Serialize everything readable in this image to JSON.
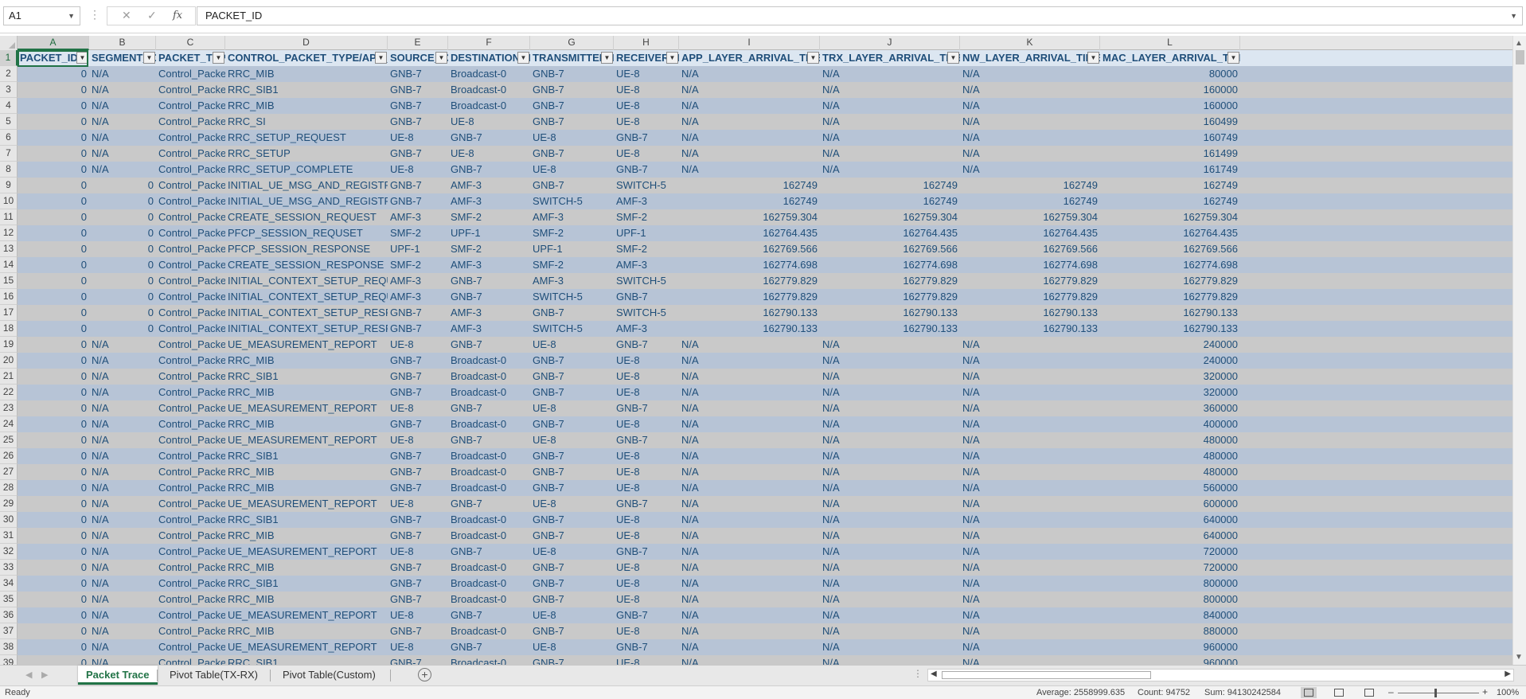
{
  "formula_bar": {
    "name_box": "A1",
    "fx_label": "fx",
    "formula": "PACKET_ID"
  },
  "columns": [
    "A",
    "B",
    "C",
    "D",
    "E",
    "F",
    "G",
    "H",
    "I",
    "J",
    "K",
    "L"
  ],
  "headers": [
    "PACKET_ID",
    "SEGMENT_ID",
    "PACKET_TYPE",
    "CONTROL_PACKET_TYPE/APP_NAME",
    "SOURCE_ID",
    "DESTINATION_ID",
    "TRANSMITTER_ID",
    "RECEIVER_ID",
    "APP_LAYER_ARRIVAL_TIME(US)",
    "TRX_LAYER_ARRIVAL_TIME(US)",
    "NW_LAYER_ARRIVAL_TIME(US)",
    "MAC_LAYER_ARRIVAL_TIME(US)"
  ],
  "rows": [
    [
      "0",
      "N/A",
      "Control_Packet",
      "RRC_MIB",
      "GNB-7",
      "Broadcast-0",
      "GNB-7",
      "UE-8",
      "N/A",
      "N/A",
      "N/A",
      "80000"
    ],
    [
      "0",
      "N/A",
      "Control_Packet",
      "RRC_SIB1",
      "GNB-7",
      "Broadcast-0",
      "GNB-7",
      "UE-8",
      "N/A",
      "N/A",
      "N/A",
      "160000"
    ],
    [
      "0",
      "N/A",
      "Control_Packet",
      "RRC_MIB",
      "GNB-7",
      "Broadcast-0",
      "GNB-7",
      "UE-8",
      "N/A",
      "N/A",
      "N/A",
      "160000"
    ],
    [
      "0",
      "N/A",
      "Control_Packet",
      "RRC_SI",
      "GNB-7",
      "UE-8",
      "GNB-7",
      "UE-8",
      "N/A",
      "N/A",
      "N/A",
      "160499"
    ],
    [
      "0",
      "N/A",
      "Control_Packet",
      "RRC_SETUP_REQUEST",
      "UE-8",
      "GNB-7",
      "UE-8",
      "GNB-7",
      "N/A",
      "N/A",
      "N/A",
      "160749"
    ],
    [
      "0",
      "N/A",
      "Control_Packet",
      "RRC_SETUP",
      "GNB-7",
      "UE-8",
      "GNB-7",
      "UE-8",
      "N/A",
      "N/A",
      "N/A",
      "161499"
    ],
    [
      "0",
      "N/A",
      "Control_Packet",
      "RRC_SETUP_COMPLETE",
      "UE-8",
      "GNB-7",
      "UE-8",
      "GNB-7",
      "N/A",
      "N/A",
      "N/A",
      "161749"
    ],
    [
      "0",
      "0",
      "Control_Packet",
      "INITIAL_UE_MSG_AND_REGISTRATION_REQUEST",
      "GNB-7",
      "AMF-3",
      "GNB-7",
      "SWITCH-5",
      "162749",
      "162749",
      "162749",
      "162749"
    ],
    [
      "0",
      "0",
      "Control_Packet",
      "INITIAL_UE_MSG_AND_REGISTRATION_REQUEST",
      "GNB-7",
      "AMF-3",
      "SWITCH-5",
      "AMF-3",
      "162749",
      "162749",
      "162749",
      "162749"
    ],
    [
      "0",
      "0",
      "Control_Packet",
      "CREATE_SESSION_REQUEST",
      "AMF-3",
      "SMF-2",
      "AMF-3",
      "SMF-2",
      "162759.304",
      "162759.304",
      "162759.304",
      "162759.304"
    ],
    [
      "0",
      "0",
      "Control_Packet",
      "PFCP_SESSION_REQUSET",
      "SMF-2",
      "UPF-1",
      "SMF-2",
      "UPF-1",
      "162764.435",
      "162764.435",
      "162764.435",
      "162764.435"
    ],
    [
      "0",
      "0",
      "Control_Packet",
      "PFCP_SESSION_RESPONSE",
      "UPF-1",
      "SMF-2",
      "UPF-1",
      "SMF-2",
      "162769.566",
      "162769.566",
      "162769.566",
      "162769.566"
    ],
    [
      "0",
      "0",
      "Control_Packet",
      "CREATE_SESSION_RESPONSE",
      "SMF-2",
      "AMF-3",
      "SMF-2",
      "AMF-3",
      "162774.698",
      "162774.698",
      "162774.698",
      "162774.698"
    ],
    [
      "0",
      "0",
      "Control_Packet",
      "INITIAL_CONTEXT_SETUP_REQUEST",
      "AMF-3",
      "GNB-7",
      "AMF-3",
      "SWITCH-5",
      "162779.829",
      "162779.829",
      "162779.829",
      "162779.829"
    ],
    [
      "0",
      "0",
      "Control_Packet",
      "INITIAL_CONTEXT_SETUP_REQUEST",
      "AMF-3",
      "GNB-7",
      "SWITCH-5",
      "GNB-7",
      "162779.829",
      "162779.829",
      "162779.829",
      "162779.829"
    ],
    [
      "0",
      "0",
      "Control_Packet",
      "INITIAL_CONTEXT_SETUP_RESPONSE_REQUEST",
      "GNB-7",
      "AMF-3",
      "GNB-7",
      "SWITCH-5",
      "162790.133",
      "162790.133",
      "162790.133",
      "162790.133"
    ],
    [
      "0",
      "0",
      "Control_Packet",
      "INITIAL_CONTEXT_SETUP_RESPONSE_REQUEST",
      "GNB-7",
      "AMF-3",
      "SWITCH-5",
      "AMF-3",
      "162790.133",
      "162790.133",
      "162790.133",
      "162790.133"
    ],
    [
      "0",
      "N/A",
      "Control_Packet",
      "UE_MEASUREMENT_REPORT",
      "UE-8",
      "GNB-7",
      "UE-8",
      "GNB-7",
      "N/A",
      "N/A",
      "N/A",
      "240000"
    ],
    [
      "0",
      "N/A",
      "Control_Packet",
      "RRC_MIB",
      "GNB-7",
      "Broadcast-0",
      "GNB-7",
      "UE-8",
      "N/A",
      "N/A",
      "N/A",
      "240000"
    ],
    [
      "0",
      "N/A",
      "Control_Packet",
      "RRC_SIB1",
      "GNB-7",
      "Broadcast-0",
      "GNB-7",
      "UE-8",
      "N/A",
      "N/A",
      "N/A",
      "320000"
    ],
    [
      "0",
      "N/A",
      "Control_Packet",
      "RRC_MIB",
      "GNB-7",
      "Broadcast-0",
      "GNB-7",
      "UE-8",
      "N/A",
      "N/A",
      "N/A",
      "320000"
    ],
    [
      "0",
      "N/A",
      "Control_Packet",
      "UE_MEASUREMENT_REPORT",
      "UE-8",
      "GNB-7",
      "UE-8",
      "GNB-7",
      "N/A",
      "N/A",
      "N/A",
      "360000"
    ],
    [
      "0",
      "N/A",
      "Control_Packet",
      "RRC_MIB",
      "GNB-7",
      "Broadcast-0",
      "GNB-7",
      "UE-8",
      "N/A",
      "N/A",
      "N/A",
      "400000"
    ],
    [
      "0",
      "N/A",
      "Control_Packet",
      "UE_MEASUREMENT_REPORT",
      "UE-8",
      "GNB-7",
      "UE-8",
      "GNB-7",
      "N/A",
      "N/A",
      "N/A",
      "480000"
    ],
    [
      "0",
      "N/A",
      "Control_Packet",
      "RRC_SIB1",
      "GNB-7",
      "Broadcast-0",
      "GNB-7",
      "UE-8",
      "N/A",
      "N/A",
      "N/A",
      "480000"
    ],
    [
      "0",
      "N/A",
      "Control_Packet",
      "RRC_MIB",
      "GNB-7",
      "Broadcast-0",
      "GNB-7",
      "UE-8",
      "N/A",
      "N/A",
      "N/A",
      "480000"
    ],
    [
      "0",
      "N/A",
      "Control_Packet",
      "RRC_MIB",
      "GNB-7",
      "Broadcast-0",
      "GNB-7",
      "UE-8",
      "N/A",
      "N/A",
      "N/A",
      "560000"
    ],
    [
      "0",
      "N/A",
      "Control_Packet",
      "UE_MEASUREMENT_REPORT",
      "UE-8",
      "GNB-7",
      "UE-8",
      "GNB-7",
      "N/A",
      "N/A",
      "N/A",
      "600000"
    ],
    [
      "0",
      "N/A",
      "Control_Packet",
      "RRC_SIB1",
      "GNB-7",
      "Broadcast-0",
      "GNB-7",
      "UE-8",
      "N/A",
      "N/A",
      "N/A",
      "640000"
    ],
    [
      "0",
      "N/A",
      "Control_Packet",
      "RRC_MIB",
      "GNB-7",
      "Broadcast-0",
      "GNB-7",
      "UE-8",
      "N/A",
      "N/A",
      "N/A",
      "640000"
    ],
    [
      "0",
      "N/A",
      "Control_Packet",
      "UE_MEASUREMENT_REPORT",
      "UE-8",
      "GNB-7",
      "UE-8",
      "GNB-7",
      "N/A",
      "N/A",
      "N/A",
      "720000"
    ],
    [
      "0",
      "N/A",
      "Control_Packet",
      "RRC_MIB",
      "GNB-7",
      "Broadcast-0",
      "GNB-7",
      "UE-8",
      "N/A",
      "N/A",
      "N/A",
      "720000"
    ],
    [
      "0",
      "N/A",
      "Control_Packet",
      "RRC_SIB1",
      "GNB-7",
      "Broadcast-0",
      "GNB-7",
      "UE-8",
      "N/A",
      "N/A",
      "N/A",
      "800000"
    ],
    [
      "0",
      "N/A",
      "Control_Packet",
      "RRC_MIB",
      "GNB-7",
      "Broadcast-0",
      "GNB-7",
      "UE-8",
      "N/A",
      "N/A",
      "N/A",
      "800000"
    ],
    [
      "0",
      "N/A",
      "Control_Packet",
      "UE_MEASUREMENT_REPORT",
      "UE-8",
      "GNB-7",
      "UE-8",
      "GNB-7",
      "N/A",
      "N/A",
      "N/A",
      "840000"
    ],
    [
      "0",
      "N/A",
      "Control_Packet",
      "RRC_MIB",
      "GNB-7",
      "Broadcast-0",
      "GNB-7",
      "UE-8",
      "N/A",
      "N/A",
      "N/A",
      "880000"
    ],
    [
      "0",
      "N/A",
      "Control_Packet",
      "UE_MEASUREMENT_REPORT",
      "UE-8",
      "GNB-7",
      "UE-8",
      "GNB-7",
      "N/A",
      "N/A",
      "N/A",
      "960000"
    ],
    [
      "0",
      "N/A",
      "Control_Packet",
      "RRC_SIB1",
      "GNB-7",
      "Broadcast-0",
      "GNB-7",
      "UE-8",
      "N/A",
      "N/A",
      "N/A",
      "960000"
    ]
  ],
  "sheet_tabs": [
    "Packet Trace",
    "Pivot Table(TX-RX)",
    "Pivot Table(Custom)"
  ],
  "active_tab": "Packet Trace",
  "status": {
    "ready": "Ready",
    "average": "Average: 2558999.635",
    "count": "Count: 94752",
    "sum": "Sum: 94130242584",
    "zoom": "100%"
  },
  "colors": {
    "header_fill": "#dce6f1",
    "band_a": "#b7c4d6",
    "band_b": "#c9c9c9",
    "text": "#1f4e79",
    "accent": "#217346"
  }
}
